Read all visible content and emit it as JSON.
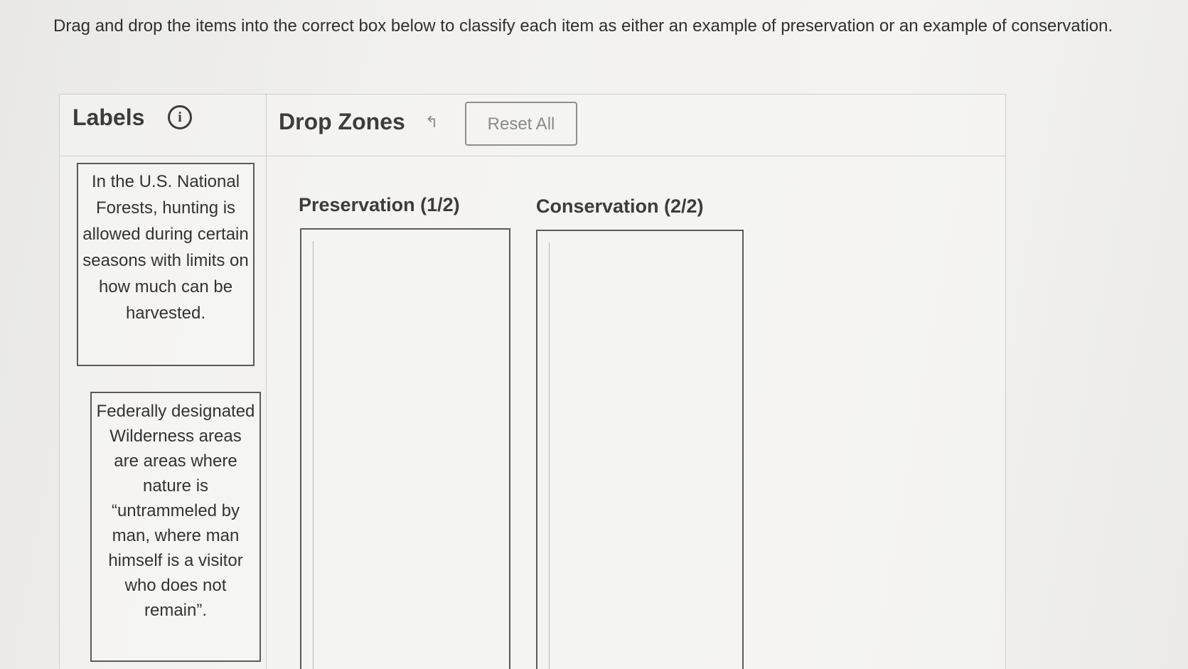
{
  "instructions": "Drag and drop the items into the correct box below to classify each item as either an example of preservation or an example of conservation.",
  "labels_panel": {
    "heading": "Labels",
    "info_icon": "info-icon",
    "items": [
      {
        "text": "In the U.S. National Forests, hunting is allowed during certain seasons with limits on how much can be harvested."
      },
      {
        "text": "Federally designated Wilderness areas are areas where nature is “untrammeled by man, where man himself is a visitor who does not remain”."
      }
    ]
  },
  "dropzones_panel": {
    "heading": "Drop Zones",
    "undo_icon": "undo-arrow-icon",
    "reset_label": "Reset All",
    "zones": [
      {
        "label": "Preservation (1/2)"
      },
      {
        "label": "Conservation (2/2)"
      }
    ]
  }
}
